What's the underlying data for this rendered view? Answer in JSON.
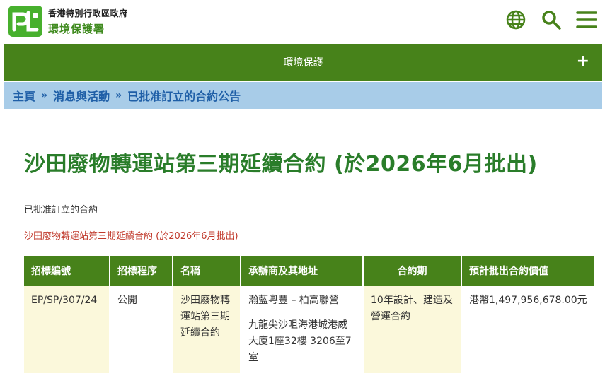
{
  "header": {
    "org_line1": "香港特別行政區政府",
    "org_line2": "環境保護署",
    "brand_green": "#47821a",
    "icons": [
      "globe-icon",
      "search-icon",
      "menu-icon"
    ]
  },
  "topic_bar": {
    "label": "環境保護",
    "expand": "+"
  },
  "breadcrumb": {
    "items": [
      "主頁",
      "消息與活動",
      "已批准訂立的合約公告"
    ],
    "separator": "»"
  },
  "main": {
    "title": "沙田廢物轉運站第三期延續合約 (於2026年6月批出)",
    "section_label": "已批准訂立的合約",
    "contract_link": "沙田廢物轉運站第三期延續合約 (於2026年6月批出)"
  },
  "table": {
    "headers": [
      "招標編號",
      "招標程序",
      "名稱",
      "承辦商及其地址",
      "合約期",
      "預計批出合約價值"
    ],
    "rows": [
      {
        "tender_no": "EP/SP/307/24",
        "procedure": "公開",
        "name": "沙田廢物轉運站第三期延續合約",
        "contractor": "瀚藍粵豐 – 柏高聯營",
        "address": "九龍尖沙咀海港城港威大廈1座32樓 3206至7室",
        "period": "10年設計、建造及營運合約",
        "value": "港幣1,497,956,678.00元"
      }
    ]
  }
}
